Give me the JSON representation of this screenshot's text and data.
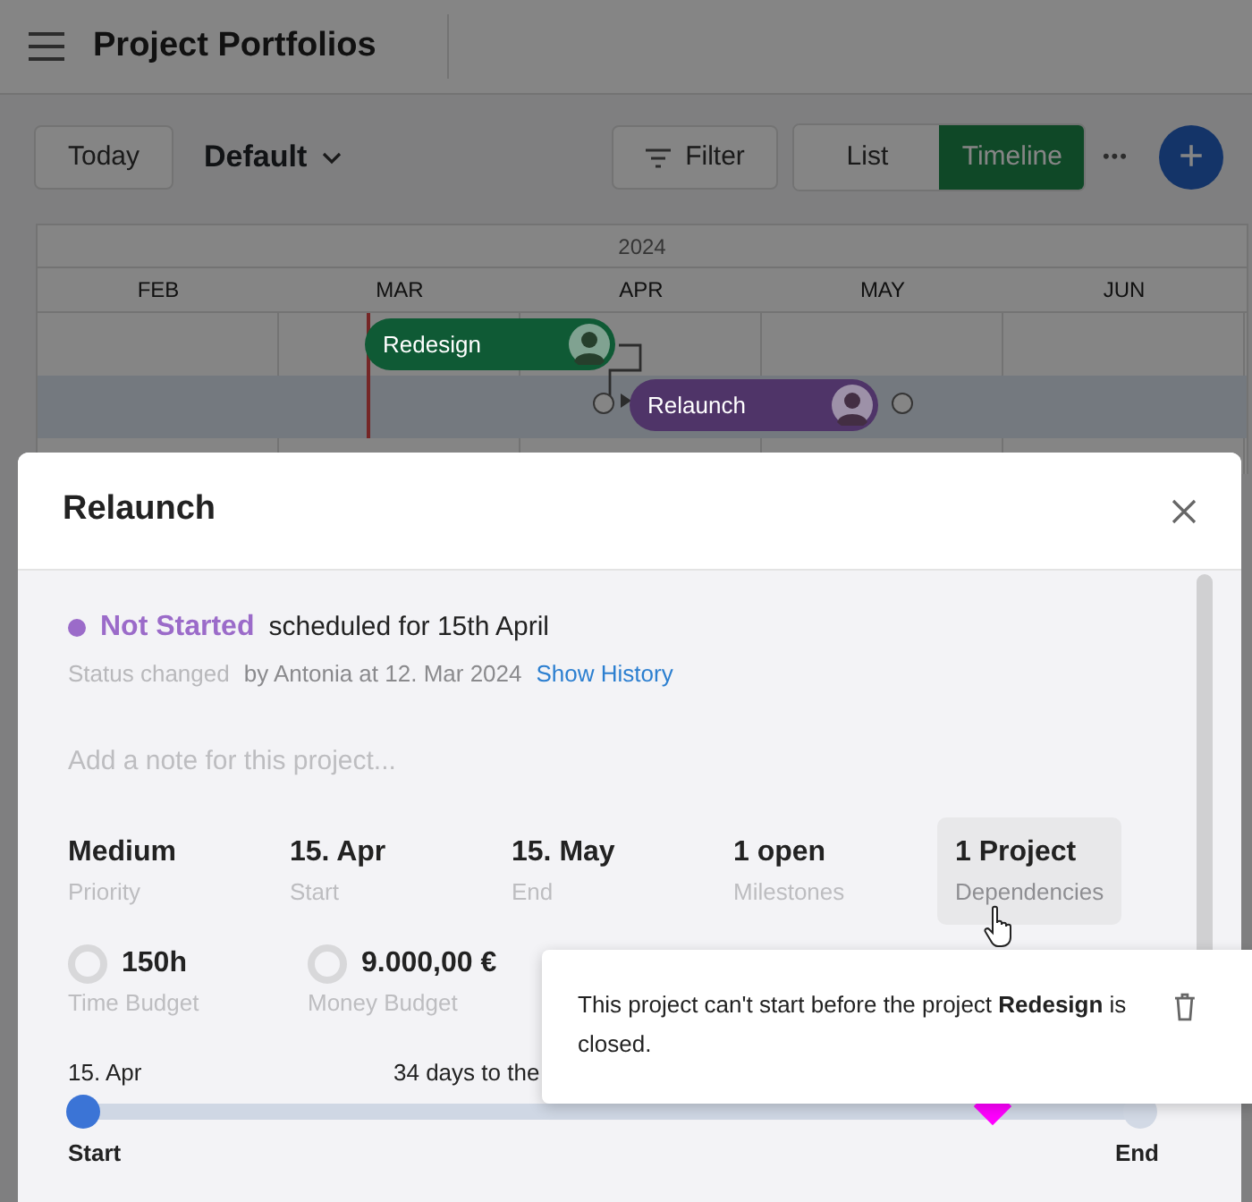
{
  "header": {
    "title": "Project Portfolios"
  },
  "toolbar": {
    "today": "Today",
    "view": "Default",
    "filter": "Filter",
    "view_tabs": [
      {
        "label": "List",
        "selected": false
      },
      {
        "label": "Timeline",
        "selected": true
      }
    ],
    "more": "•••",
    "add": "+"
  },
  "timeline": {
    "year": "2024",
    "months": [
      "FEB",
      "MAR",
      "APR",
      "MAY",
      "JUN"
    ],
    "bars": [
      {
        "label": "Redesign",
        "color": "#0f5a35"
      },
      {
        "label": "Relaunch",
        "color": "#4f3468"
      }
    ]
  },
  "modal": {
    "title": "Relaunch",
    "status": {
      "label": "Not Started",
      "color": "#9b6bc9"
    },
    "schedule": "scheduled for 15th April",
    "changed_label": "Status changed",
    "changed_by": "by Antonia at 12. Mar 2024",
    "history_link": "Show History",
    "note": {
      "placeholder": "Add a note for this project..."
    },
    "facts": [
      {
        "value": "Medium",
        "label": "Priority",
        "selected": false
      },
      {
        "value": "15. Apr",
        "label": "Start",
        "selected": false
      },
      {
        "value": "15. May",
        "label": "End",
        "selected": false
      },
      {
        "value": "1 open",
        "label": "Milestones",
        "selected": false
      },
      {
        "value": "1 Project",
        "label": "Dependencies",
        "selected": true
      }
    ],
    "budgets": [
      {
        "value": "150h",
        "label": "Time Budget"
      },
      {
        "value": "9.000,00 €",
        "label": "Money Budget"
      }
    ],
    "progress": {
      "start_date": "15. Apr",
      "caption": "34 days to the",
      "start_label": "Start",
      "end_label": "End",
      "level": 0.86
    }
  },
  "tooltip": {
    "text": "This project can't start before the project **Redesign** is closed."
  }
}
